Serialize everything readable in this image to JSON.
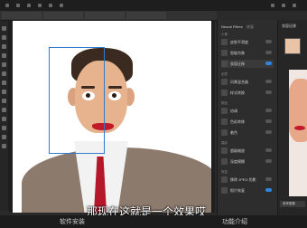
{
  "subtitle": "那现在这就是一个效果哎",
  "statusbar": {
    "left_label": "软件安装",
    "right_label": "功能介绍"
  },
  "panel": {
    "tabs": [
      "Neural Filters",
      "修复"
    ],
    "sections": {
      "portrait": "人像",
      "creative": "创意",
      "color": "颜色",
      "photography": "摄影",
      "restore": "恢复"
    },
    "rows": [
      {
        "label": "皮肤平滑度",
        "on": false,
        "selected": false
      },
      {
        "label": "智能肖像",
        "on": false,
        "selected": false
      },
      {
        "label": "妆容迁移",
        "on": true,
        "selected": true
      },
      {
        "label": "风景混合器",
        "on": false,
        "selected": false
      },
      {
        "label": "样式转换",
        "on": false,
        "selected": false
      },
      {
        "label": "协调",
        "on": false,
        "selected": false
      },
      {
        "label": "色彩转移",
        "on": false,
        "selected": false
      },
      {
        "label": "着色",
        "on": false,
        "selected": false
      },
      {
        "label": "超级缩放",
        "on": false,
        "selected": false
      },
      {
        "label": "深度模糊",
        "on": false,
        "selected": false
      },
      {
        "label": "移除 JPEG 伪影",
        "on": false,
        "selected": false
      },
      {
        "label": "照片恢复",
        "on": true,
        "selected": false
      }
    ]
  },
  "rpanel": {
    "title": "妆容迁移",
    "button": "参考图像"
  },
  "colors": {
    "accent": "#2d86e0",
    "selection": "#2f7bd1",
    "tie": "#b5172a",
    "lips": "#c21a2b"
  }
}
